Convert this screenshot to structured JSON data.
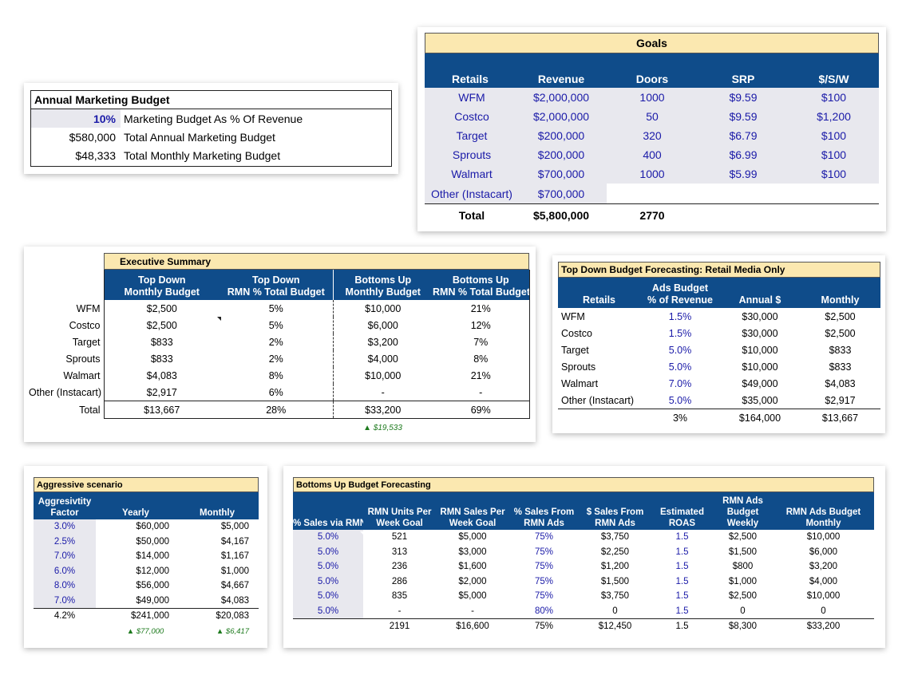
{
  "annual_budget": {
    "title": "Annual Marketing Budget",
    "rows": [
      {
        "value": "10%",
        "label": "Marketing Budget As % Of Revenue"
      },
      {
        "value": "$580,000",
        "label": "Total Annual Marketing Budget"
      },
      {
        "value": "$48,333",
        "label": "Total Monthly Marketing Budget"
      }
    ]
  },
  "goals": {
    "title": "Goals",
    "headers": [
      "Retails",
      "Revenue",
      "Doors",
      "SRP",
      "$/S/W"
    ],
    "rows": [
      [
        "WFM",
        "$2,000,000",
        "1000",
        "$9.59",
        "$100"
      ],
      [
        "Costco",
        "$2,000,000",
        "50",
        "$9.59",
        "$1,200"
      ],
      [
        "Target",
        "$200,000",
        "320",
        "$6.79",
        "$100"
      ],
      [
        "Sprouts",
        "$200,000",
        "400",
        "$6.99",
        "$100"
      ],
      [
        "Walmart",
        "$700,000",
        "1000",
        "$5.99",
        "$100"
      ],
      [
        "Other (Instacart)",
        "$700,000",
        "",
        "",
        ""
      ]
    ],
    "total": [
      "Total",
      "$5,800,000",
      "2770",
      "",
      ""
    ]
  },
  "executive_summary": {
    "title": "Executive Summary",
    "headers": [
      [
        "Top Down",
        "Monthly Budget"
      ],
      [
        "Top Down",
        "RMN % Total Budget"
      ],
      [
        "Bottoms Up",
        "Monthly Budget"
      ],
      [
        "Bottoms Up",
        "RMN % Total Budget"
      ]
    ],
    "rows": [
      [
        "WFM",
        "$2,500",
        "5%",
        "$10,000",
        "21%"
      ],
      [
        "Costco",
        "$2,500",
        "5%",
        "$6,000",
        "12%"
      ],
      [
        "Target",
        "$833",
        "2%",
        "$3,200",
        "7%"
      ],
      [
        "Sprouts",
        "$833",
        "2%",
        "$4,000",
        "8%"
      ],
      [
        "Walmart",
        "$4,083",
        "8%",
        "$10,000",
        "21%"
      ],
      [
        "Other (Instacart)",
        "$2,917",
        "6%",
        "-",
        "-"
      ]
    ],
    "total": [
      "Total",
      "$13,667",
      "28%",
      "$33,200",
      "69%"
    ],
    "delta": "▲ $19,533"
  },
  "top_down": {
    "title": "Top Down Budget Forecasting: Retail Media Only",
    "headers": [
      [
        "Retails"
      ],
      [
        "Ads Budget",
        "% of Revenue"
      ],
      [
        "Annual $"
      ],
      [
        "Monthly"
      ]
    ],
    "rows": [
      [
        "WFM",
        "1.5%",
        "$30,000",
        "$2,500"
      ],
      [
        "Costco",
        "1.5%",
        "$30,000",
        "$2,500"
      ],
      [
        "Target",
        "5.0%",
        "$10,000",
        "$833"
      ],
      [
        "Sprouts",
        "5.0%",
        "$10,000",
        "$833"
      ],
      [
        "Walmart",
        "7.0%",
        "$49,000",
        "$4,083"
      ],
      [
        "Other (Instacart)",
        "5.0%",
        "$35,000",
        "$2,917"
      ]
    ],
    "total": [
      "",
      "3%",
      "$164,000",
      "$13,667"
    ]
  },
  "aggressive": {
    "title": "Aggressive scenario",
    "headers": [
      [
        "Aggresivtity",
        "Factor"
      ],
      [
        "Yearly"
      ],
      [
        "Monthly"
      ]
    ],
    "rows": [
      [
        "3.0%",
        "$60,000",
        "$5,000"
      ],
      [
        "2.5%",
        "$50,000",
        "$4,167"
      ],
      [
        "7.0%",
        "$14,000",
        "$1,167"
      ],
      [
        "6.0%",
        "$12,000",
        "$1,000"
      ],
      [
        "8.0%",
        "$56,000",
        "$4,667"
      ],
      [
        "7.0%",
        "$49,000",
        "$4,083"
      ]
    ],
    "total": [
      "4.2%",
      "$241,000",
      "$20,083"
    ],
    "deltas": [
      "▲ $77,000",
      "▲ $6,417"
    ]
  },
  "bottoms_up": {
    "title": "Bottoms Up Budget Forecasting",
    "headers": [
      [
        "% Sales via RMN"
      ],
      [
        "RMN Units Per",
        "Week Goal"
      ],
      [
        "RMN Sales Per",
        "Week Goal"
      ],
      [
        "% Sales From",
        "RMN Ads"
      ],
      [
        "$ Sales From",
        "RMN Ads"
      ],
      [
        "Estimated",
        "ROAS"
      ],
      [
        "RMN Ads",
        "Budget",
        "Weekly"
      ],
      [
        "RMN Ads Budget",
        "Monthly"
      ]
    ],
    "rows": [
      [
        "5.0%",
        "521",
        "$5,000",
        "75%",
        "$3,750",
        "1.5",
        "$2,500",
        "$10,000"
      ],
      [
        "5.0%",
        "313",
        "$3,000",
        "75%",
        "$2,250",
        "1.5",
        "$1,500",
        "$6,000"
      ],
      [
        "5.0%",
        "236",
        "$1,600",
        "75%",
        "$1,200",
        "1.5",
        "$800",
        "$3,200"
      ],
      [
        "5.0%",
        "286",
        "$2,000",
        "75%",
        "$1,500",
        "1.5",
        "$1,000",
        "$4,000"
      ],
      [
        "5.0%",
        "835",
        "$5,000",
        "75%",
        "$3,750",
        "1.5",
        "$2,500",
        "$10,000"
      ],
      [
        "5.0%",
        "-",
        "-",
        "80%",
        "0",
        "1.5",
        "0",
        "0"
      ]
    ],
    "total": [
      "",
      "2191",
      "$16,600",
      "75%",
      "$12,450",
      "1.5",
      "$8,300",
      "$33,200"
    ]
  },
  "colors": {
    "header_blue": "#0f4c8a",
    "title_yellow": "#fbe8b0",
    "input_blue": "#1a1aa8",
    "delta_green": "#1d7a1d"
  }
}
